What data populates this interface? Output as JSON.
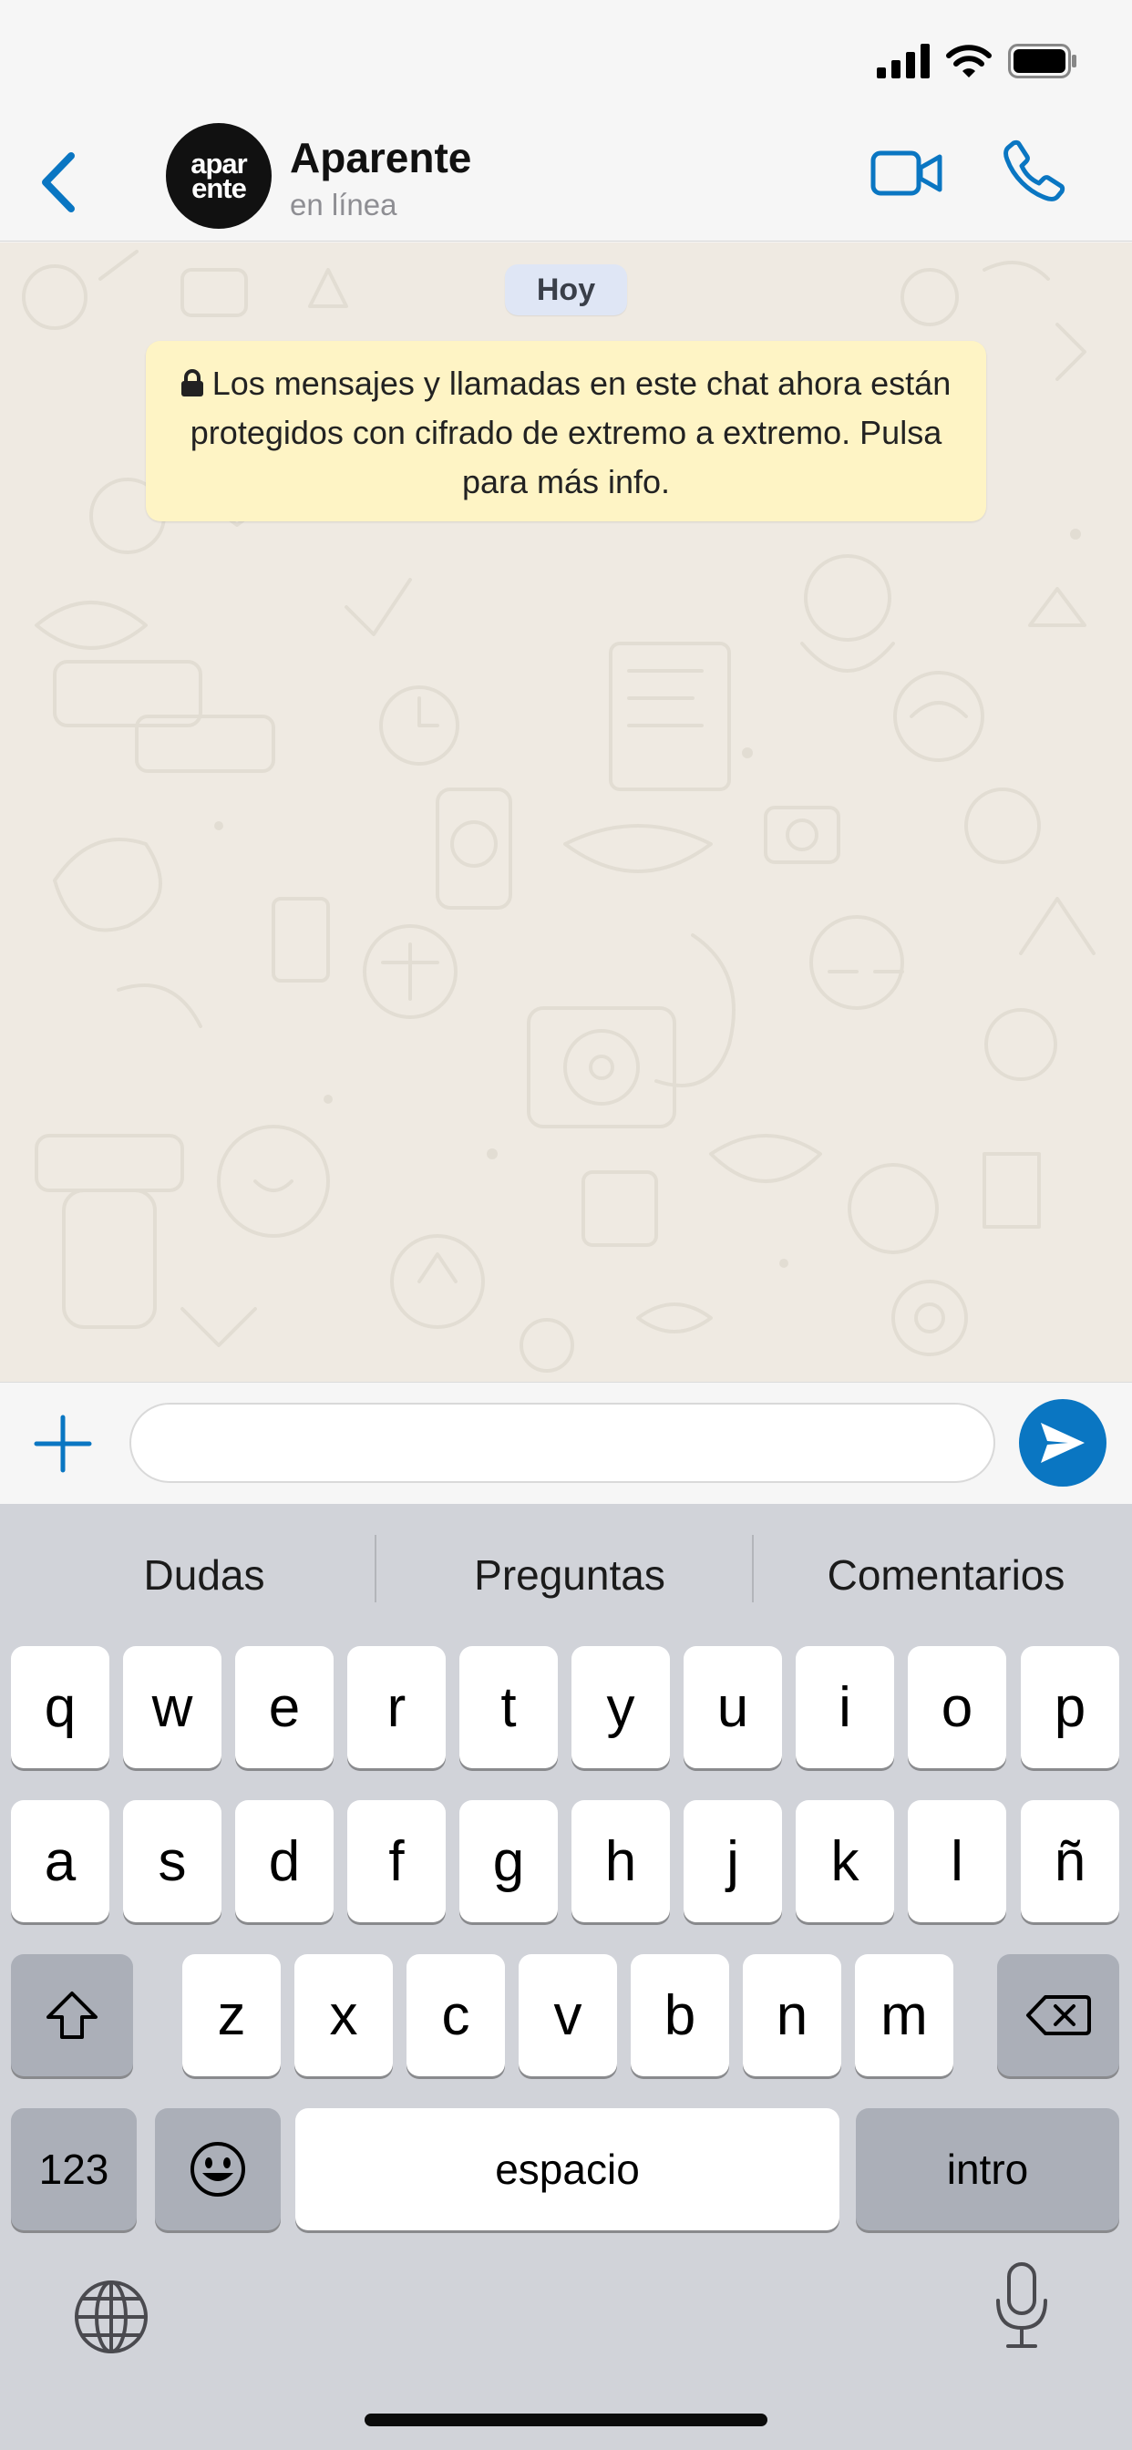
{
  "header": {
    "contact_name": "Aparente",
    "contact_status": "en línea",
    "avatar_line1": "apar",
    "avatar_line2": "ente"
  },
  "chat": {
    "date_label": "Hoy",
    "encryption_notice": "Los mensajes y llamadas en este chat ahora están protegidos con cifrado de extremo a extremo. Pulsa para más info."
  },
  "input": {
    "value": "",
    "placeholder": ""
  },
  "keyboard": {
    "suggestions": [
      "Dudas",
      "Preguntas",
      "Comentarios"
    ],
    "row1": [
      "q",
      "w",
      "e",
      "r",
      "t",
      "y",
      "u",
      "i",
      "o",
      "p"
    ],
    "row2": [
      "a",
      "s",
      "d",
      "f",
      "g",
      "h",
      "j",
      "k",
      "l",
      "ñ"
    ],
    "row3": [
      "z",
      "x",
      "c",
      "v",
      "b",
      "n",
      "m"
    ],
    "numbers_label": "123",
    "space_label": "espacio",
    "return_label": "intro"
  },
  "icons": {
    "back": "chevron-left-icon",
    "video": "video-camera-icon",
    "call": "phone-icon",
    "attach": "plus-icon",
    "send": "send-icon",
    "shift": "shift-icon",
    "delete": "backspace-icon",
    "emoji": "emoji-icon",
    "globe": "globe-icon",
    "mic": "microphone-icon"
  },
  "colors": {
    "accent": "#0a76c2",
    "notice_bg": "#fef4c5",
    "date_bg": "#dfe6f5",
    "chat_bg": "#efeae2",
    "keyboard_bg": "#d1d3d9"
  }
}
